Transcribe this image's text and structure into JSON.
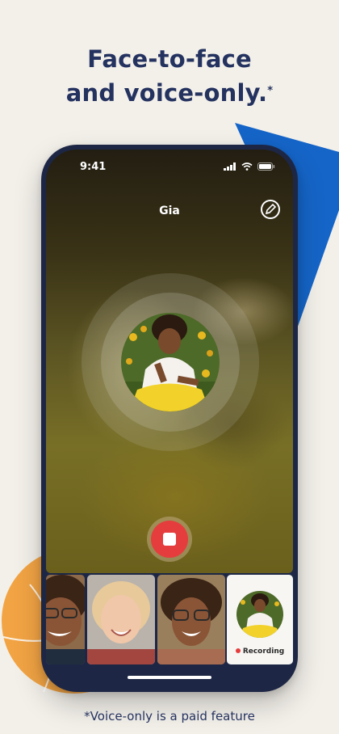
{
  "headline": {
    "line1": "Face-to-face",
    "line2": "and voice-only.",
    "asterisk": "*"
  },
  "footnote": "*Voice-only is a paid feature",
  "status_bar": {
    "time": "9:41",
    "icons": [
      "signal-icon",
      "wifi-icon",
      "battery-icon"
    ]
  },
  "call": {
    "name": "Gia",
    "edit_icon": "pencil-icon",
    "record_icon": "stop-icon"
  },
  "participants": [
    {
      "name_icon": "participant-1"
    },
    {
      "name_icon": "participant-2"
    },
    {
      "name_icon": "participant-3"
    }
  ],
  "self_tile": {
    "status_label": "Recording"
  },
  "colors": {
    "background": "#f3f0ea",
    "navy": "#24325f",
    "blue_accent": "#1565c8",
    "orange_accent": "#f2a444",
    "record_red": "#e53d3d"
  }
}
